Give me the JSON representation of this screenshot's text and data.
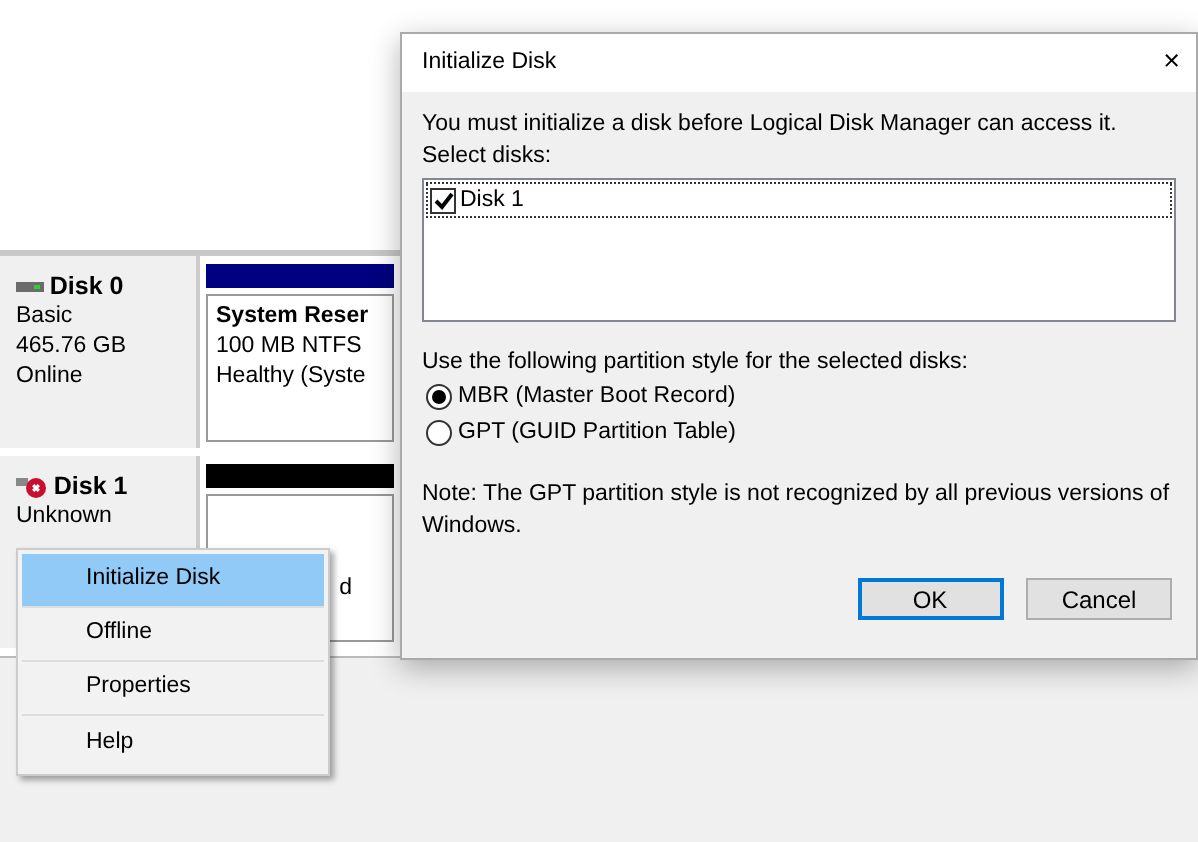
{
  "disks": [
    {
      "kind": "online",
      "name": "Disk 0",
      "type": "Basic",
      "size": "465.76 GB",
      "status": "Online",
      "partition": {
        "name": "System Reser",
        "detail": "100 MB NTFS",
        "health": "Healthy (Syste"
      }
    },
    {
      "kind": "unknown",
      "name": "Disk 1",
      "type": "Unknown",
      "partition": {
        "fragment": "d"
      }
    }
  ],
  "context_menu": [
    {
      "label": "Initialize Disk",
      "selected": true
    },
    {
      "label": "Offline",
      "selected": false
    },
    {
      "label": "Properties",
      "selected": false
    },
    {
      "label": "Help",
      "selected": false
    }
  ],
  "dialog": {
    "title": "Initialize Disk",
    "close": "×",
    "message": "You must initialize a disk before Logical Disk Manager can access it.",
    "select_label": "Select disks:",
    "disks": [
      {
        "label": "Disk 1",
        "checked": true
      }
    ],
    "style_label": "Use the following partition style for the selected disks:",
    "styles": [
      {
        "label": "MBR (Master Boot Record)",
        "selected": true
      },
      {
        "label": "GPT (GUID Partition Table)",
        "selected": false
      }
    ],
    "note": "Note: The GPT partition style is not recognized by all previous versions of Windows.",
    "buttons": [
      {
        "label": "OK",
        "default": true
      },
      {
        "label": "Cancel",
        "default": false
      }
    ]
  }
}
